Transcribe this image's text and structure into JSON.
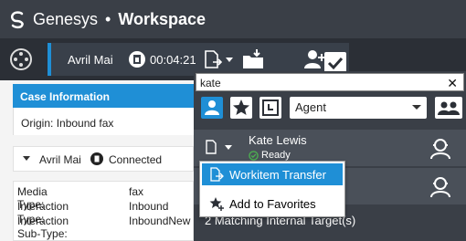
{
  "titlebar": {
    "brand": "Genesys",
    "separator": "•",
    "app_name": "Workspace"
  },
  "toolbar": {
    "agent": "Avril Mai",
    "timer": "00:04:21"
  },
  "case": {
    "header": "Case Information",
    "origin_label": "Origin:",
    "origin_value": "Inbound fax"
  },
  "party": {
    "name": "Avril Mai",
    "status": "Connected"
  },
  "case_data": [
    {
      "key": "Media Type:",
      "value": "fax"
    },
    {
      "key": "Interaction Type:",
      "value": "Inbound"
    },
    {
      "key": "Interaction Sub-Type:",
      "value": "InboundNew"
    }
  ],
  "team_communicator": {
    "search_value": "kate",
    "clear": "✕",
    "filter_value": "Agent",
    "results": [
      {
        "name": "Kate Lewis",
        "status": "Ready"
      }
    ],
    "match_count": "2 Matching Internal Target(s)"
  },
  "menu": {
    "items": [
      {
        "label": "Workitem Transfer",
        "active": true
      },
      {
        "label": "Add to Favorites",
        "active": false
      }
    ]
  },
  "colors": {
    "accent": "#1f8fd6",
    "titlebar": "#3a3f47",
    "ready": "#4caf50"
  }
}
